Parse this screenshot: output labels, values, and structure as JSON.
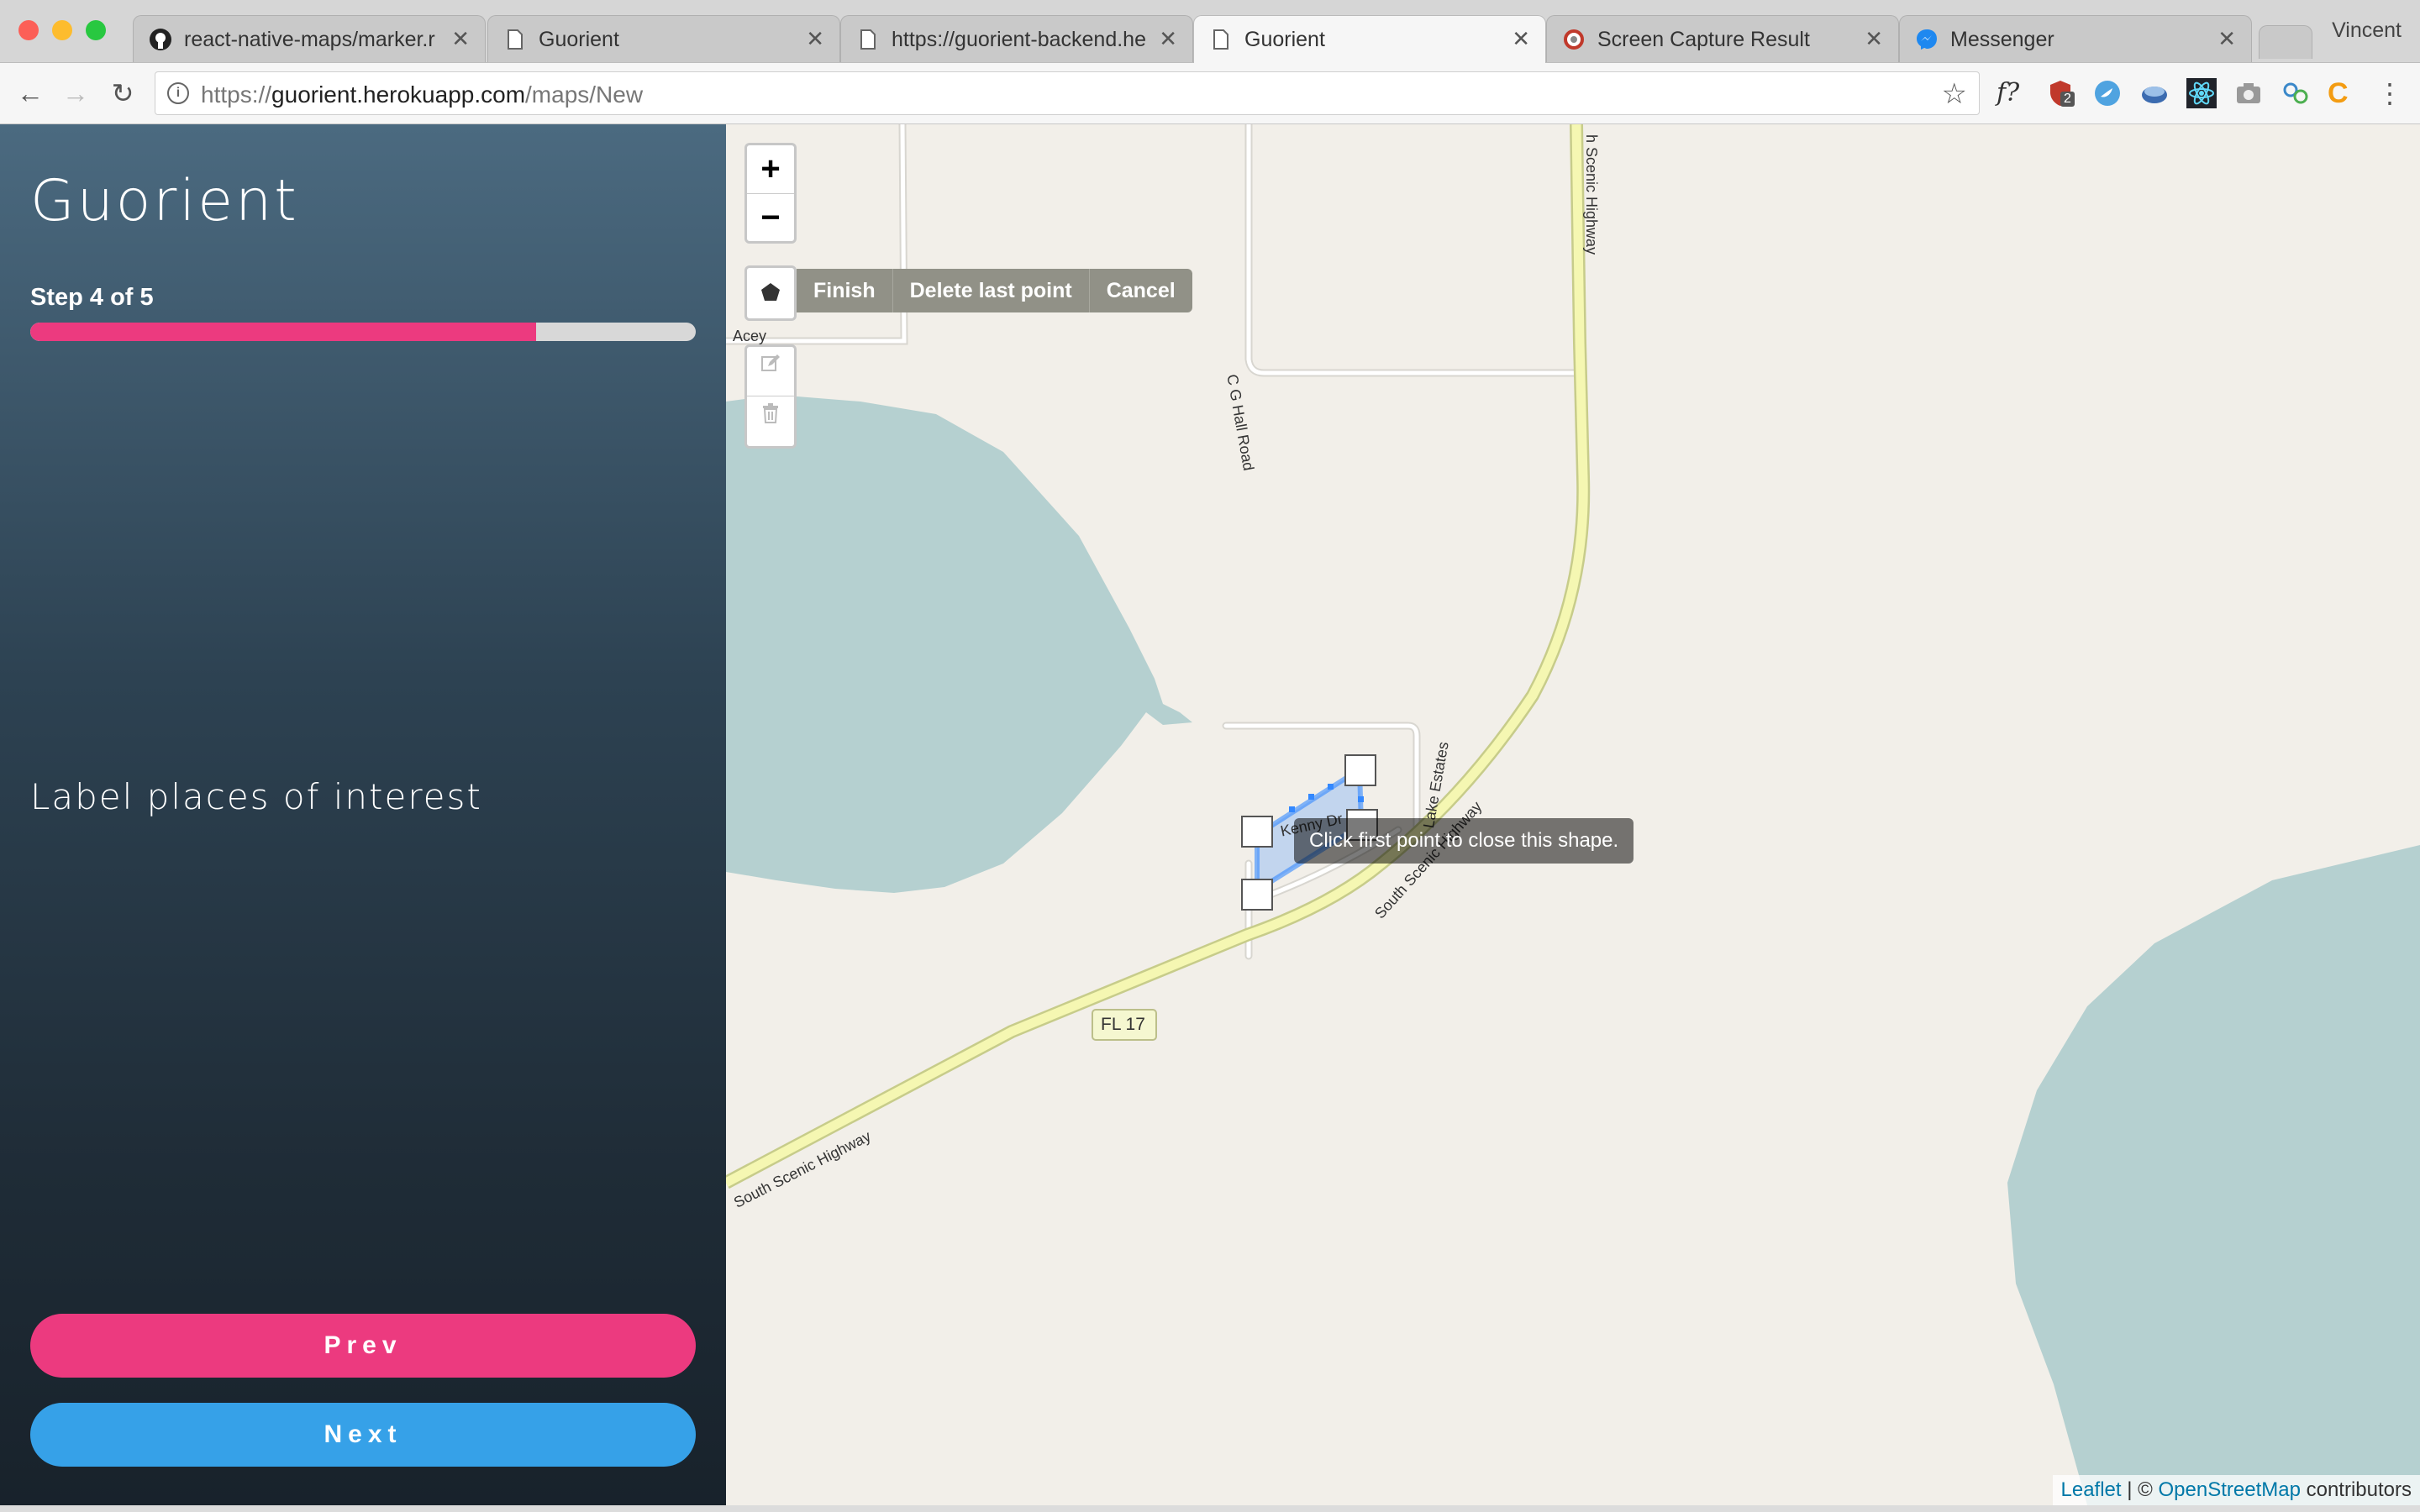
{
  "browser": {
    "tabs": [
      {
        "title": "react-native-maps/marker.r",
        "icon": "github-icon",
        "active": false
      },
      {
        "title": "Guorient",
        "icon": "page-icon",
        "active": false
      },
      {
        "title": "https://guorient-backend.he",
        "icon": "page-icon",
        "active": false
      },
      {
        "title": "Guorient",
        "icon": "page-icon",
        "active": true
      },
      {
        "title": "Screen Capture Result",
        "icon": "capture-icon",
        "active": false
      },
      {
        "title": "Messenger",
        "icon": "messenger-icon",
        "active": false
      }
    ],
    "profile_name": "Vincent",
    "url_prefix": "https://",
    "url_host": "guorient.herokuapp.com",
    "url_path": "/maps/New",
    "extension_badge": "2",
    "fx_label": "f?"
  },
  "sidebar": {
    "app_title": "Guorient",
    "step_label": "Step 4 of 5",
    "progress_fraction": 0.76,
    "heading": "Label places of interest",
    "prev_label": "Prev",
    "next_label": "Next",
    "colors": {
      "accent_pink": "#ec3a7f",
      "accent_blue": "#36a1e8"
    }
  },
  "map": {
    "zoom_in": "+",
    "zoom_out": "−",
    "draw_actions": {
      "finish": "Finish",
      "delete_last": "Delete last point",
      "cancel": "Cancel"
    },
    "tooltip": "Click first point to close this shape.",
    "labels": {
      "acey": "Acey",
      "cg_hall": "C G Hall Road",
      "scenic_top": "h Scenic Highway",
      "scenic_mid": "South Scenic Highway",
      "scenic_bottom": "South Scenic Highway",
      "lake_estates": "Lake Estates",
      "kenny": "Kenny Dr",
      "fl17": "FL 17"
    },
    "attribution": {
      "leaflet": "Leaflet",
      "separator": " | © ",
      "osm": "OpenStreetMap",
      "suffix": " contributors"
    },
    "colors": {
      "land": "#f2efe9",
      "water": "#b5d0d0",
      "highway": "#f5f7b2",
      "highway_edge": "#c7cc8a",
      "road": "#ffffff",
      "polygon": "#3388ff"
    }
  }
}
